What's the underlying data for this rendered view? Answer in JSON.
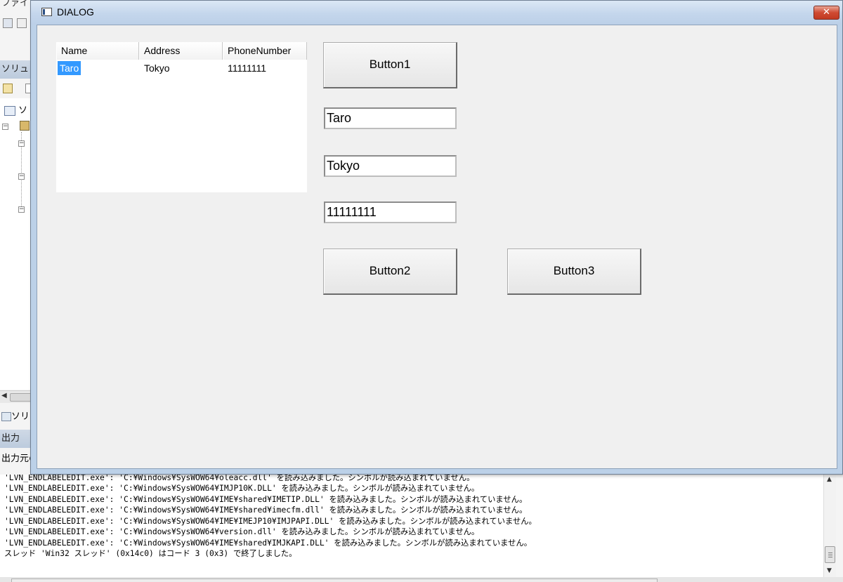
{
  "ide": {
    "menu_fragment": "ファイ",
    "solution_explorer_header": "ソリュ",
    "tree_root_fragment": "ソ",
    "solution_tab_label": "ソリュ",
    "output_header": "出力",
    "output_source_label": "出力元の",
    "output": {
      "lines": [
        "'LVN_ENDLABELEDIT.exe': 'C:¥Windows¥SysWOW64¥oleacc.dll' を読み込みました。シンボルが読み込まれていません。",
        "'LVN_ENDLABELEDIT.exe': 'C:¥Windows¥SysWOW64¥IMJP10K.DLL' を読み込みました。シンボルが読み込まれていません。",
        "'LVN_ENDLABELEDIT.exe': 'C:¥Windows¥SysWOW64¥IME¥shared¥IMETIP.DLL' を読み込みました。シンボルが読み込まれていません。",
        "'LVN_ENDLABELEDIT.exe': 'C:¥Windows¥SysWOW64¥IME¥shared¥imecfm.dll' を読み込みました。シンボルが読み込まれていません。",
        "'LVN_ENDLABELEDIT.exe': 'C:¥Windows¥SysWOW64¥IME¥IMEJP10¥IMJPAPI.DLL' を読み込みました。シンボルが読み込まれていません。",
        "'LVN_ENDLABELEDIT.exe': 'C:¥Windows¥SysWOW64¥version.dll' を読み込みました。シンボルが読み込まれていません。",
        "'LVN_ENDLABELEDIT.exe': 'C:¥Windows¥SysWOW64¥IME¥shared¥IMJKAPI.DLL' を読み込みました。シンボルが読み込まれていません。",
        "スレッド 'Win32 スレッド' (0x14c0) はコード 3 (0x3) で終了しました。"
      ]
    }
  },
  "dialog": {
    "title": "DIALOG",
    "close_symbol": "✕",
    "listview": {
      "columns": [
        "Name",
        "Address",
        "PhoneNumber"
      ],
      "rows": [
        {
          "name": "Taro",
          "address": "Tokyo",
          "phone": "11111111"
        }
      ]
    },
    "button1_label": "Button1",
    "button2_label": "Button2",
    "button3_label": "Button3",
    "name_value": "Taro",
    "address_value": "Tokyo",
    "phone_value": "11111111"
  },
  "colors": {
    "selection": "#3399ff",
    "titlebar": "#c4d6ec",
    "close_button": "#cf4a32"
  }
}
